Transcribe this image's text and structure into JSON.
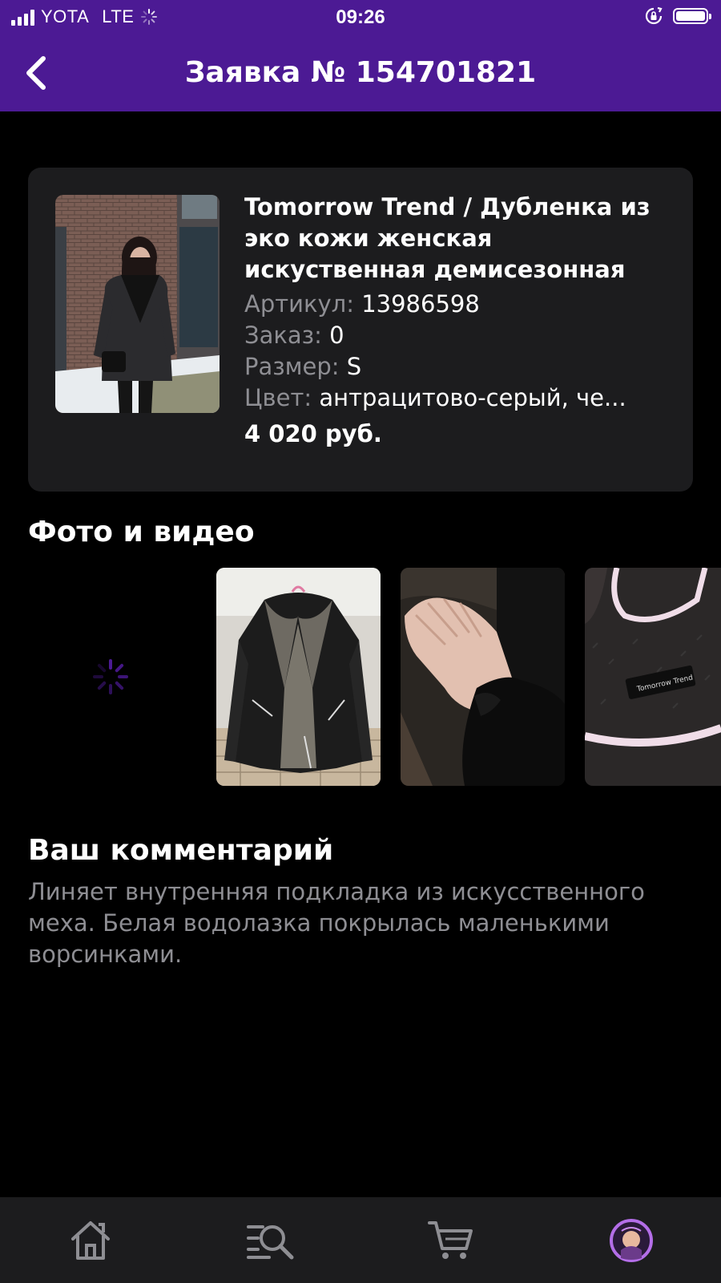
{
  "status_bar": {
    "carrier": "YOTA",
    "network": "LTE",
    "time": "09:26"
  },
  "header": {
    "title": "Заявка № 154701821"
  },
  "product": {
    "title": "Tomorrow Trend / Дубленка из эко кожи женская искуственная демисезонная",
    "article_label": "Артикул:",
    "article_value": "13986598",
    "order_label": "Заказ:",
    "order_value": "0",
    "size_label": "Размер:",
    "size_value": "S",
    "color_label": "Цвет:",
    "color_value": "антрацитово-серый, че...",
    "price": "4 020 руб."
  },
  "media": {
    "title": "Фото и видео",
    "label_text": "Tomorrow Trend"
  },
  "comment": {
    "title": "Ваш комментарий",
    "text": "Линяет внутренняя подкладка из искусственного меха. Белая водолазка покрылась маленькими ворсинками."
  },
  "tab_bar": {
    "items": [
      "home-icon",
      "catalog-search-icon",
      "cart-icon",
      "profile-avatar-icon"
    ]
  },
  "colors": {
    "accent": "#4c1a94",
    "card": "#1c1c1e",
    "secondary_text": "#8e8e93"
  }
}
